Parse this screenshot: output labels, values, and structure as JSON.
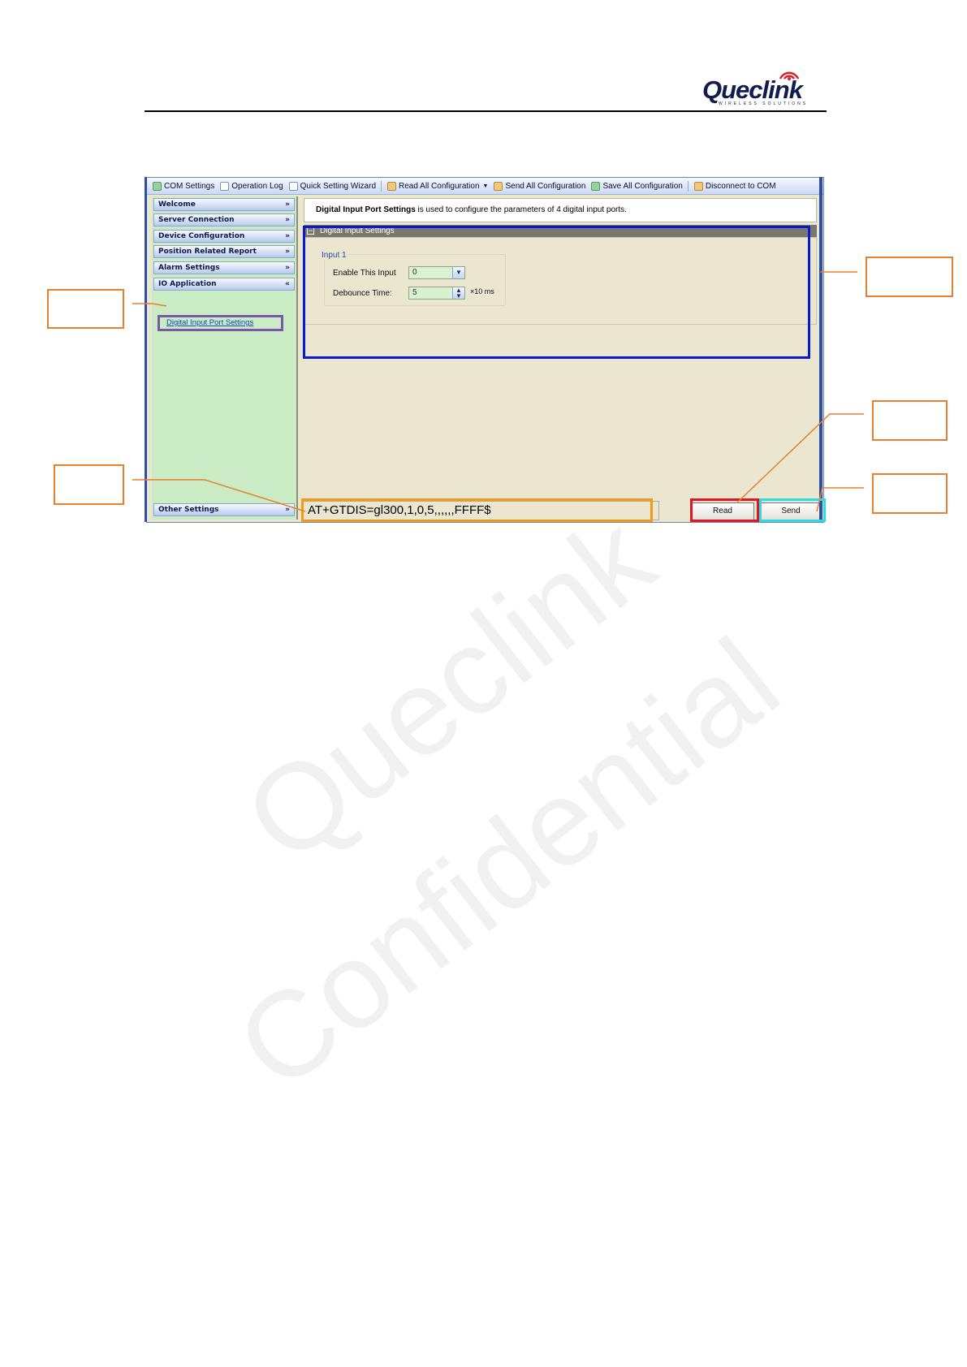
{
  "header": {
    "logo_text": "Queclink",
    "logo_subtitle": "WIRELESS SOLUTIONS"
  },
  "watermark": {
    "line1": "Queclink",
    "line2": "Confidential"
  },
  "toolbar": {
    "items": [
      {
        "label": "COM Settings",
        "icon": "com-settings-icon"
      },
      {
        "label": "Operation Log",
        "icon": "log-icon"
      },
      {
        "label": "Quick Setting Wizard",
        "icon": "wizard-icon"
      },
      {
        "label": "Read All Configuration",
        "icon": "read-config-icon"
      },
      {
        "label": "Send All Configuration",
        "icon": "send-config-icon"
      },
      {
        "label": "Save All Configuration",
        "icon": "save-config-icon"
      },
      {
        "label": "Disconnect to COM",
        "icon": "disconnect-icon"
      }
    ]
  },
  "sidebar": {
    "items": [
      {
        "label": "Welcome",
        "chevron": "»"
      },
      {
        "label": "Server Connection",
        "chevron": "»"
      },
      {
        "label": "Device Configuration",
        "chevron": "»"
      },
      {
        "label": "Position Related Report",
        "chevron": "»"
      },
      {
        "label": "Alarm Settings",
        "chevron": "»"
      },
      {
        "label": "IO Application",
        "chevron": "«"
      }
    ],
    "sub_item": "Digital Input Port Settings",
    "bottom_item": {
      "label": "Other Settings",
      "chevron": "»"
    }
  },
  "main": {
    "description_bold": "Digital Input Port Settings",
    "description_rest": " is used to configure the parameters of 4 digital input ports.",
    "group_title": "Digital Input Settings",
    "group_toggle": "−",
    "input_title": "Input 1",
    "enable_label": "Enable This Input",
    "enable_value": "0",
    "debounce_label": "Debounce Time:",
    "debounce_value": "5",
    "debounce_unit": "×10 ms",
    "command": "AT+GTDIS=gl300,1,0,5,,,,,,FFFF$",
    "read_button": "Read",
    "send_button": "Send"
  },
  "colors": {
    "callout": "#e77f2c",
    "highlight_blue": "#0a1ad0",
    "highlight_orange": "#f39a17",
    "highlight_red": "#e4151e",
    "highlight_cyan": "#2cdbe5",
    "highlight_purple": "#7b58a7"
  }
}
